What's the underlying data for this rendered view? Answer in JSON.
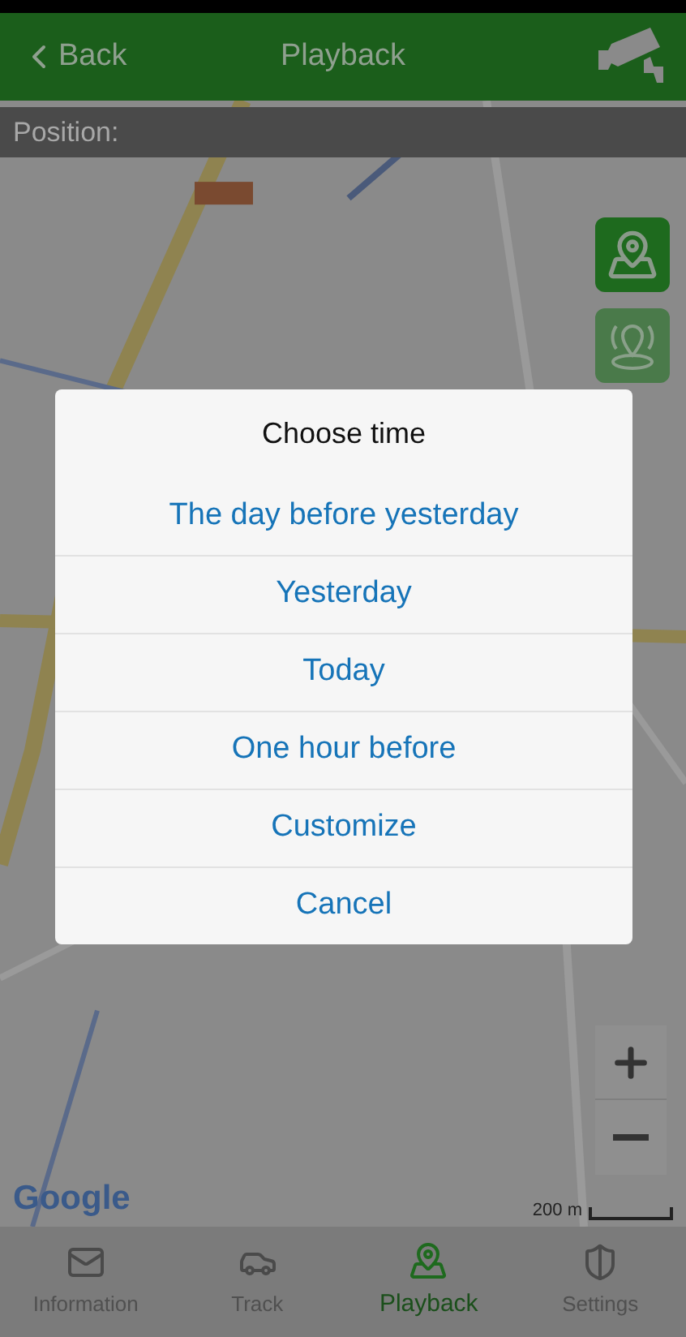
{
  "header": {
    "back": "Back",
    "title": "Playback"
  },
  "position_label": "Position:",
  "map": {
    "attribution": "Google",
    "scale": "200 m"
  },
  "dialog": {
    "title": "Choose time",
    "options": [
      "The day before yesterday",
      "Yesterday",
      "Today",
      "One hour before",
      "Customize",
      "Cancel"
    ]
  },
  "bottom_nav": [
    {
      "label": "Information",
      "selected": false
    },
    {
      "label": "Track",
      "selected": false
    },
    {
      "label": "Playback",
      "selected": true
    },
    {
      "label": "Settings",
      "selected": false
    }
  ]
}
